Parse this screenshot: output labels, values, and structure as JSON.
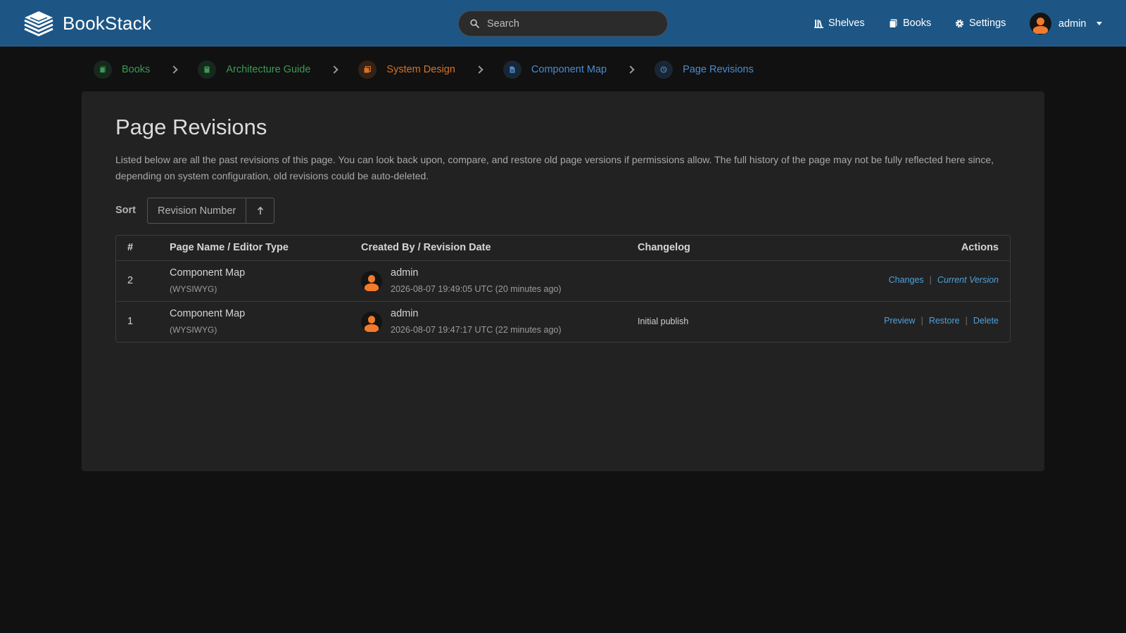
{
  "app": {
    "name": "BookStack"
  },
  "search": {
    "placeholder": "Search"
  },
  "nav": {
    "shelves": "Shelves",
    "books": "Books",
    "settings": "Settings"
  },
  "user": {
    "name": "admin"
  },
  "breadcrumbs": [
    {
      "label": "Books",
      "icon": "books-icon",
      "color": "#3a9a55"
    },
    {
      "label": "Architecture Guide",
      "icon": "book-icon",
      "color": "#3a9a55"
    },
    {
      "label": "System Design",
      "icon": "chapter-icon",
      "color": "#d4732a"
    },
    {
      "label": "Component Map",
      "icon": "page-icon",
      "color": "#4a8bd0"
    },
    {
      "label": "Page Revisions",
      "icon": "history-icon",
      "color": "#4a8bd0"
    }
  ],
  "page": {
    "title": "Page Revisions",
    "description": "Listed below are all the past revisions of this page. You can look back upon, compare, and restore old page versions if permissions allow. The full history of the page may not be fully reflected here since, depending on system configuration, old revisions could be auto-deleted."
  },
  "sort": {
    "label": "Sort",
    "value": "Revision Number",
    "direction": "↑"
  },
  "table": {
    "headers": {
      "num": "#",
      "name": "Page Name / Editor Type",
      "created": "Created By / Revision Date",
      "changelog": "Changelog",
      "actions": "Actions"
    },
    "rows": [
      {
        "num": "2",
        "name": "Component Map",
        "type": "(WYSIWYG)",
        "user": "admin",
        "date": "2026-08-07 19:49:05 UTC (20 minutes ago)",
        "changelog": "",
        "actions": {
          "a1": "Changes",
          "a2": "Current Version"
        }
      },
      {
        "num": "1",
        "name": "Component Map",
        "type": "(WYSIWYG)",
        "user": "admin",
        "date": "2026-08-07 19:47:17 UTC (22 minutes ago)",
        "changelog": "Initial publish",
        "actions": {
          "a1": "Preview",
          "a2": "Restore",
          "a3": "Delete"
        }
      }
    ]
  },
  "colors": {
    "header": "#1d5685",
    "link": "#4fa1dc",
    "avatar": "#f27a2c",
    "book": "#3a9a55",
    "chapter": "#d4732a",
    "page": "#4a8bd0"
  }
}
